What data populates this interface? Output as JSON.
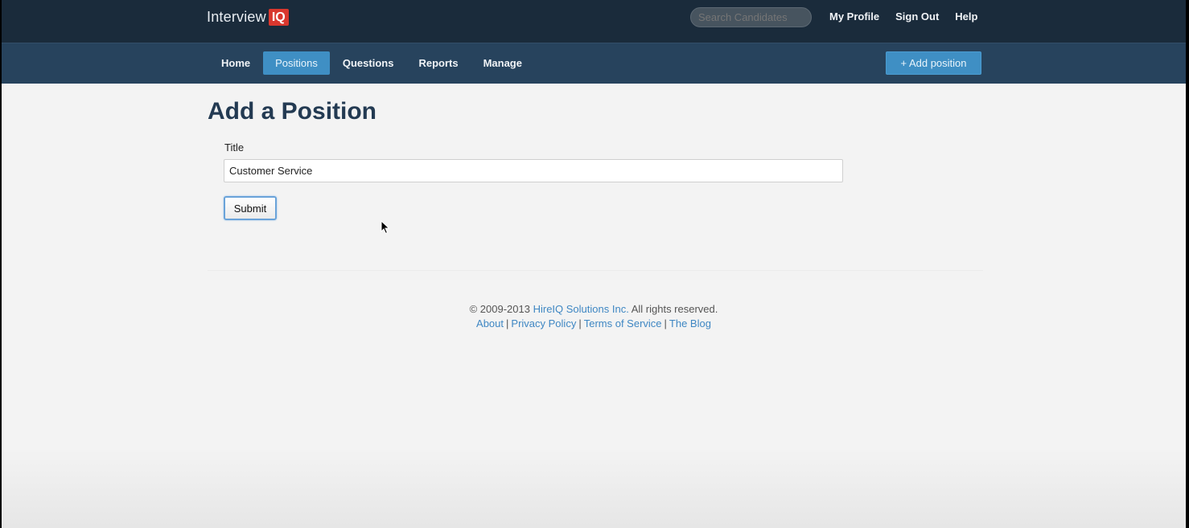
{
  "header": {
    "logo_text": "Interview",
    "logo_badge": "IQ",
    "search_placeholder": "Search Candidates",
    "links": [
      "My Profile",
      "Sign Out",
      "Help"
    ]
  },
  "nav": {
    "items": [
      "Home",
      "Positions",
      "Questions",
      "Reports",
      "Manage"
    ],
    "active": "Positions",
    "add_button": "+ Add position"
  },
  "main": {
    "title": "Add a Position",
    "field_label": "Title",
    "field_value": "Customer Service",
    "submit_label": "Submit"
  },
  "footer": {
    "copyright_prefix": "© 2009-2013",
    "company_link": "HireIQ Solutions Inc.",
    "copyright_suffix": "All rights reserved.",
    "links": [
      "About",
      "Privacy Policy",
      "Terms of Service",
      "The Blog"
    ]
  },
  "colors": {
    "topbar": "#1a2b3b",
    "navbar": "#27435d",
    "accent": "#3f8fc4",
    "logo_badge": "#d9372e",
    "link": "#3f87c3"
  }
}
